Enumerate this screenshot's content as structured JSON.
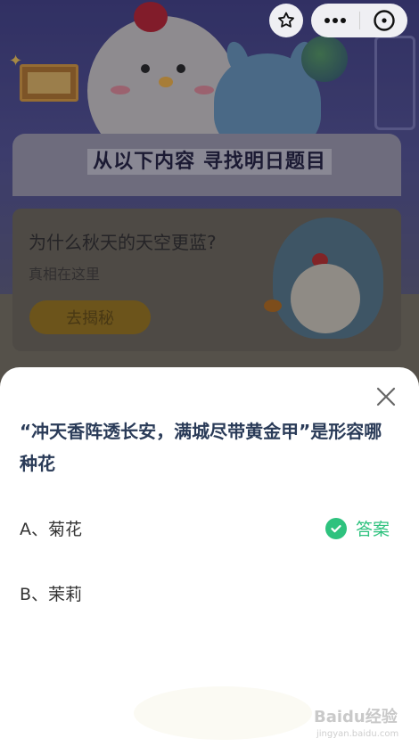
{
  "header": {
    "favorite_icon": "star-icon",
    "more_icon": "more-icon",
    "close_icon": "close-circle-icon"
  },
  "banner": {
    "title": "从以下内容 寻找明日题目"
  },
  "card": {
    "title": "为什么秋天的天空更蓝?",
    "subtitle": "真相在这里",
    "button_label": "去揭秘"
  },
  "quiz": {
    "question": "“冲天香阵透长安，满城尽带黄金甲”是形容哪种花",
    "options": [
      {
        "label": "A、菊花",
        "is_answer": true
      },
      {
        "label": "B、茉莉",
        "is_answer": false
      }
    ],
    "answer_label": "答案",
    "accent_color": "#2ec27e"
  },
  "watermark": {
    "brand": "Baidu经验",
    "url": "jingyan.baidu.com"
  }
}
